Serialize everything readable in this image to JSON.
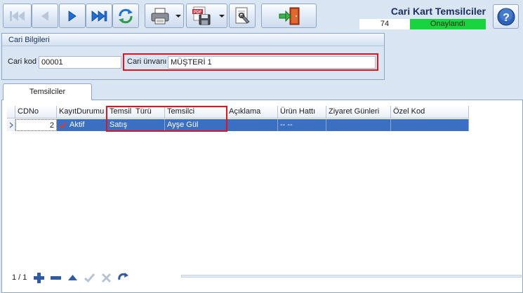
{
  "header": {
    "title": "Cari Kart Temsilciler",
    "record_no": "74",
    "status": "Onaylandı"
  },
  "toolbar": {
    "icons": [
      "first-record-icon",
      "prev-record-icon",
      "next-record-icon",
      "last-record-icon",
      "refresh-icon",
      "print-icon",
      "pdf-save-icon",
      "document-settings-icon",
      "exit-icon",
      "help-icon"
    ]
  },
  "cari": {
    "group_title": "Cari Bilgileri",
    "kod_label": "Cari kod",
    "kod_value": "00001",
    "unvan_label": "Cari ünvanı",
    "unvan_value": "MÜŞTERİ 1"
  },
  "tabs": [
    "Temsilciler"
  ],
  "grid": {
    "columns": [
      "CDNo",
      "KayıtDurumu",
      "Temsil  Türü",
      "Temsilci",
      "Açıklama",
      "Ürün Hattı",
      "Ziyaret Günleri",
      "Özel Kod"
    ],
    "rows": [
      {
        "cdno": "2",
        "kayit_durumu": "Aktif",
        "temsil_turu": "Satış",
        "temsilci": "Ayşe Gül",
        "aciklama": "",
        "urun_hatti": "-- --",
        "ziyaret_gunleri": "",
        "ozel_kod": ""
      }
    ]
  },
  "navigator": {
    "count": "1 / 1",
    "icons": [
      "add-icon",
      "remove-icon",
      "move-up-icon",
      "confirm-icon",
      "cancel-icon",
      "refresh-icon"
    ]
  }
}
